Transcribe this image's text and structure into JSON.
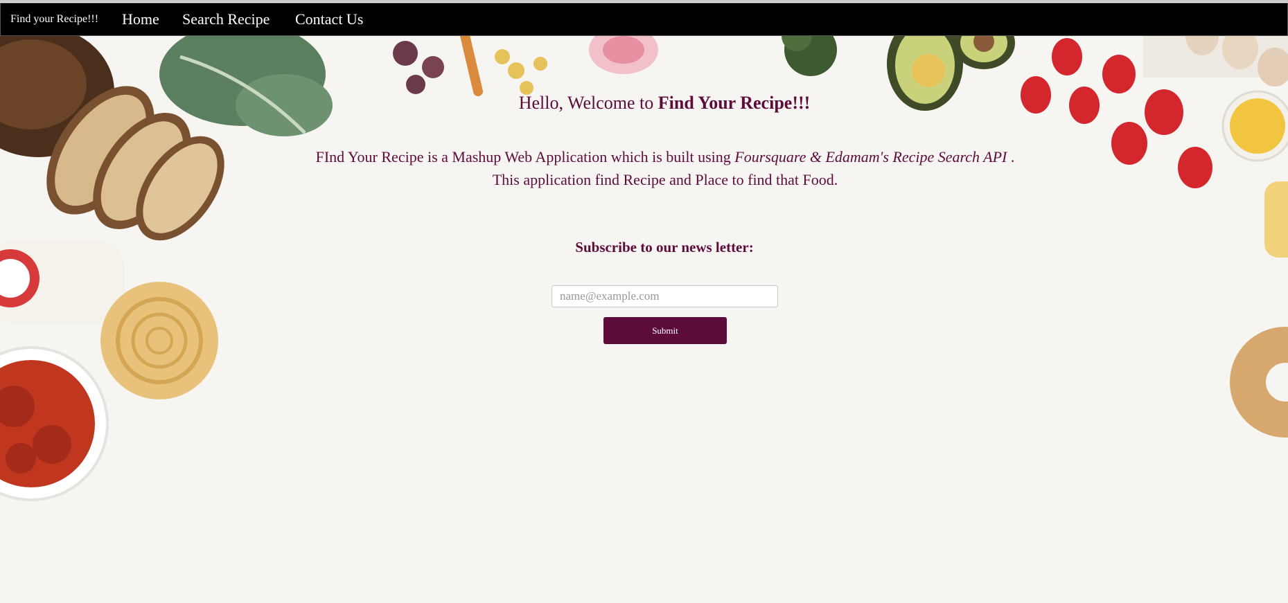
{
  "nav": {
    "brand": "Find your Recipe!!!",
    "links": [
      "Home",
      "Search Recipe",
      "Contact Us"
    ]
  },
  "hero": {
    "welcome_prefix": "Hello, Welcome to ",
    "welcome_strong": "Find Your Recipe!!!",
    "desc_prefix": "FInd Your Recipe is a Mashup Web Application which is built using ",
    "desc_italic": "Foursquare & Edamam's Recipe Search API",
    "desc_suffix": " . This application find Recipe and Place to find that Food."
  },
  "newsletter": {
    "title": "Subscribe to our news letter:",
    "email_placeholder": "name@example.com",
    "submit_label": "Submit"
  },
  "colors": {
    "brand": "#5c0b3a",
    "nav_bg": "#000000",
    "page_bg": "#f7f5f2"
  }
}
